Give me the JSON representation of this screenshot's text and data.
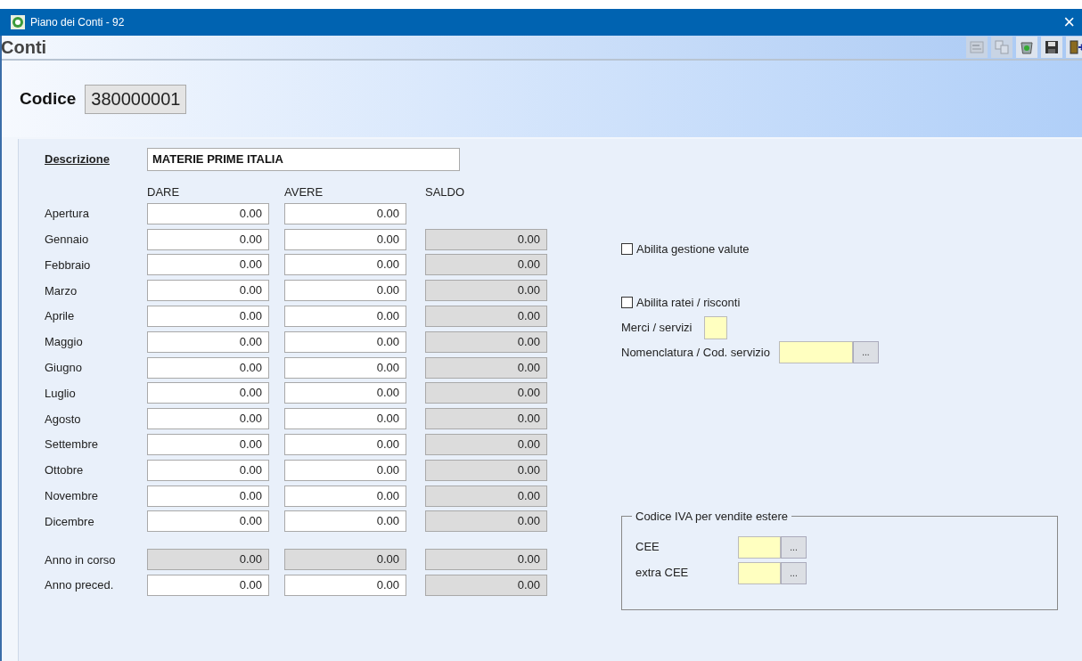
{
  "window": {
    "title": "Piano dei Conti - 92",
    "close": "×"
  },
  "toolbar": {
    "title": "Conti",
    "buttons": [
      {
        "kind": "report",
        "disabled": true
      },
      {
        "kind": "copy",
        "disabled": true
      },
      {
        "kind": "recycle",
        "disabled": false
      },
      {
        "kind": "save",
        "disabled": false
      },
      {
        "kind": "exit",
        "disabled": false
      }
    ]
  },
  "codice": {
    "label": "Codice",
    "value": "380000001"
  },
  "descrizione": {
    "label": "Descrizione",
    "value": "MATERIE PRIME ITALIA"
  },
  "columns": [
    "DARE",
    "AVERE",
    "SALDO"
  ],
  "rows": [
    {
      "label": "Apertura",
      "cells": [
        {
          "value": "0.00",
          "disabled": false
        },
        {
          "value": "0.00",
          "disabled": false
        }
      ]
    },
    {
      "label": "Gennaio",
      "cells": [
        {
          "value": "0.00",
          "disabled": false
        },
        {
          "value": "0.00",
          "disabled": false
        },
        {
          "value": "0.00",
          "disabled": true
        }
      ]
    },
    {
      "label": "Febbraio",
      "cells": [
        {
          "value": "0.00",
          "disabled": false
        },
        {
          "value": "0.00",
          "disabled": false
        },
        {
          "value": "0.00",
          "disabled": true
        }
      ]
    },
    {
      "label": "Marzo",
      "cells": [
        {
          "value": "0.00",
          "disabled": false
        },
        {
          "value": "0.00",
          "disabled": false
        },
        {
          "value": "0.00",
          "disabled": true
        }
      ]
    },
    {
      "label": "Aprile",
      "cells": [
        {
          "value": "0.00",
          "disabled": false
        },
        {
          "value": "0.00",
          "disabled": false
        },
        {
          "value": "0.00",
          "disabled": true
        }
      ]
    },
    {
      "label": "Maggio",
      "cells": [
        {
          "value": "0.00",
          "disabled": false
        },
        {
          "value": "0.00",
          "disabled": false
        },
        {
          "value": "0.00",
          "disabled": true
        }
      ]
    },
    {
      "label": "Giugno",
      "cells": [
        {
          "value": "0.00",
          "disabled": false
        },
        {
          "value": "0.00",
          "disabled": false
        },
        {
          "value": "0.00",
          "disabled": true
        }
      ]
    },
    {
      "label": "Luglio",
      "cells": [
        {
          "value": "0.00",
          "disabled": false
        },
        {
          "value": "0.00",
          "disabled": false
        },
        {
          "value": "0.00",
          "disabled": true
        }
      ]
    },
    {
      "label": "Agosto",
      "cells": [
        {
          "value": "0.00",
          "disabled": false
        },
        {
          "value": "0.00",
          "disabled": false
        },
        {
          "value": "0.00",
          "disabled": true
        }
      ]
    },
    {
      "label": "Settembre",
      "cells": [
        {
          "value": "0.00",
          "disabled": false
        },
        {
          "value": "0.00",
          "disabled": false
        },
        {
          "value": "0.00",
          "disabled": true
        }
      ]
    },
    {
      "label": "Ottobre",
      "cells": [
        {
          "value": "0.00",
          "disabled": false
        },
        {
          "value": "0.00",
          "disabled": false
        },
        {
          "value": "0.00",
          "disabled": true
        }
      ]
    },
    {
      "label": "Novembre",
      "cells": [
        {
          "value": "0.00",
          "disabled": false
        },
        {
          "value": "0.00",
          "disabled": false
        },
        {
          "value": "0.00",
          "disabled": true
        }
      ]
    },
    {
      "label": "Dicembre",
      "cells": [
        {
          "value": "0.00",
          "disabled": false
        },
        {
          "value": "0.00",
          "disabled": false
        },
        {
          "value": "0.00",
          "disabled": true
        }
      ]
    }
  ],
  "totals": [
    {
      "label": "Anno in corso",
      "cells": [
        {
          "value": "0.00",
          "disabled": true
        },
        {
          "value": "0.00",
          "disabled": true
        },
        {
          "value": "0.00",
          "disabled": true
        }
      ]
    },
    {
      "label": "Anno preced.",
      "cells": [
        {
          "value": "0.00",
          "disabled": false
        },
        {
          "value": "0.00",
          "disabled": false
        },
        {
          "value": "0.00",
          "disabled": true
        }
      ]
    }
  ],
  "options": {
    "valute": {
      "label": "Abilita gestione valute",
      "checked": false
    },
    "ratei": {
      "label": "Abilita ratei / risconti",
      "checked": false
    },
    "merci": {
      "label": "Merci / servizi"
    },
    "nomenclatura": {
      "label": "Nomenclatura / Cod. servizio",
      "button": "..."
    }
  },
  "iva": {
    "title": "Codice IVA per vendite estere",
    "fields": [
      {
        "label": "CEE",
        "button": "..."
      },
      {
        "label": "extra CEE",
        "button": "..."
      }
    ]
  }
}
